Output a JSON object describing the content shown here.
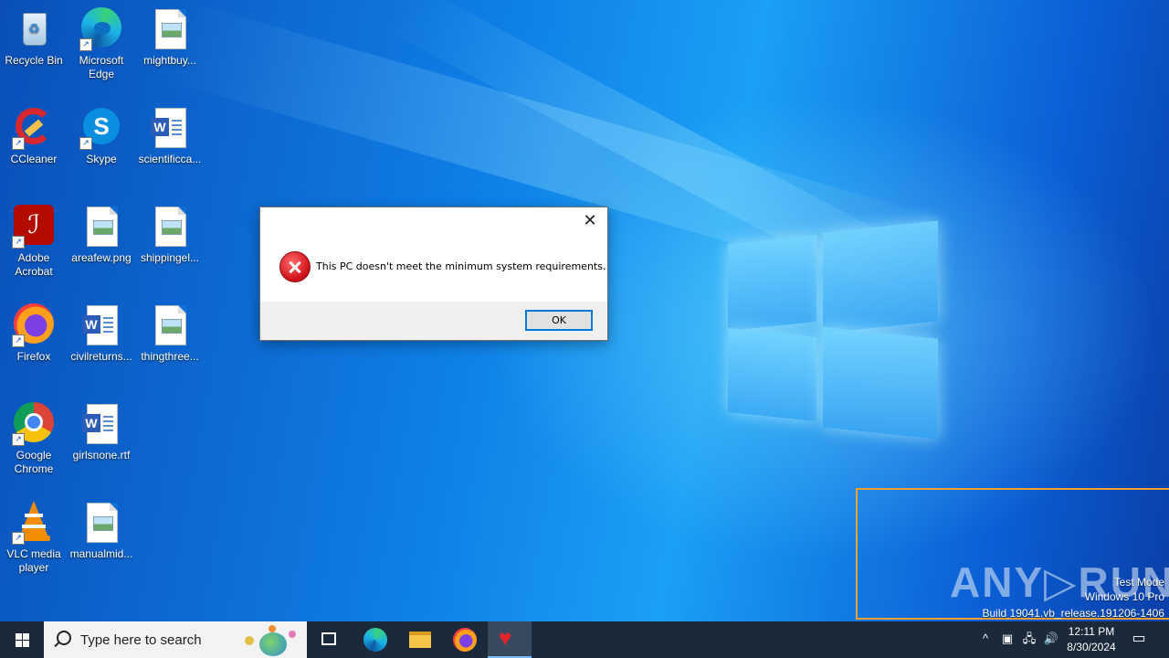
{
  "desktop_icons": [
    {
      "label": "Recycle Bin",
      "icon": "recycle-bin-icon"
    },
    {
      "label": "Microsoft Edge",
      "icon": "edge-icon"
    },
    {
      "label": "mightbuy...",
      "icon": "image-file-icon"
    },
    {
      "label": "CCleaner",
      "icon": "ccleaner-icon"
    },
    {
      "label": "Skype",
      "icon": "skype-icon"
    },
    {
      "label": "scientificca...",
      "icon": "word-doc-icon"
    },
    {
      "label": "Adobe Acrobat",
      "icon": "acrobat-icon"
    },
    {
      "label": "areafew.png",
      "icon": "image-file-icon"
    },
    {
      "label": "shippingel...",
      "icon": "image-file-icon"
    },
    {
      "label": "Firefox",
      "icon": "firefox-icon"
    },
    {
      "label": "civilreturns...",
      "icon": "word-doc-icon"
    },
    {
      "label": "thingthree...",
      "icon": "image-file-icon"
    },
    {
      "label": "Google Chrome",
      "icon": "chrome-icon"
    },
    {
      "label": "girlsnone.rtf",
      "icon": "word-doc-icon"
    },
    {
      "label": "VLC media player",
      "icon": "vlc-icon"
    },
    {
      "label": "manualmid...",
      "icon": "image-file-icon"
    }
  ],
  "dialog": {
    "message": "This PC doesn't meet the minimum system requirements.",
    "ok_label": "OK",
    "close_glyph": "✕"
  },
  "watermark": {
    "brand": "ANY▷RUN",
    "test_mode": "Test Mode",
    "edition": "Windows 10 Pro",
    "build": "Build 19041.vb_release.191206-1406"
  },
  "taskbar": {
    "search_placeholder": "Type here to search",
    "apps": [
      "task-view-icon",
      "edge-icon",
      "file-explorer-icon",
      "firefox-icon",
      "heart-app-icon"
    ],
    "clock_time": "12:11 PM",
    "clock_date": "8/30/2024"
  },
  "colors": {
    "taskbar": "#1b2a3a",
    "dialog_footer": "#f0f0f0",
    "ok_border": "#0078d7",
    "overlay_border": "#f0a030"
  }
}
